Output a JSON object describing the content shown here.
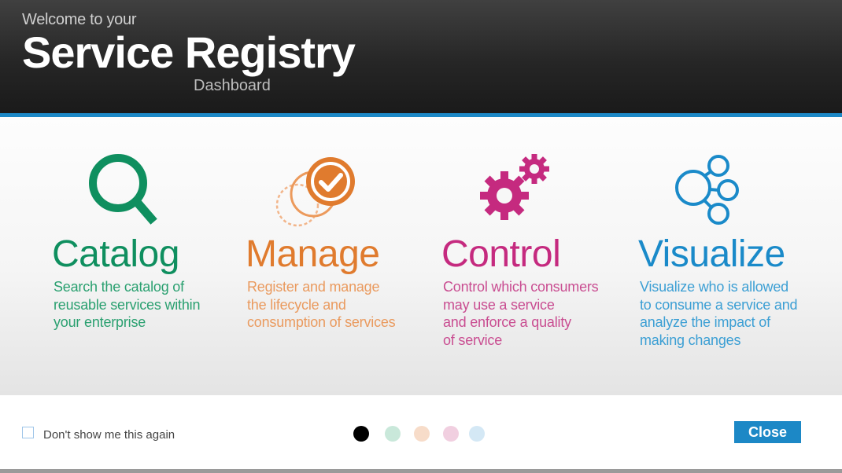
{
  "header": {
    "welcome": "Welcome to your",
    "title": "Service Registry",
    "subtitle": "Dashboard"
  },
  "features": [
    {
      "title": "Catalog",
      "icon": "magnifier-icon",
      "color": "#0f8f5f",
      "text_color": "#2aa070",
      "lines": [
        "Search the catalog of",
        "reusable services within",
        "your enterprise"
      ]
    },
    {
      "title": "Manage",
      "icon": "checkmark-circles-icon",
      "color": "#e07b2e",
      "text_color": "#ea9a5e",
      "lines": [
        "Register and manage",
        "the lifecycle and",
        "consumption of services"
      ]
    },
    {
      "title": "Control",
      "icon": "gears-icon",
      "color": "#c52a7f",
      "text_color": "#c94d91",
      "lines": [
        "Control which consumers",
        "may use a service",
        "and enforce a quality",
        "of service"
      ]
    },
    {
      "title": "Visualize",
      "icon": "network-icon",
      "color": "#1a8ac9",
      "text_color": "#3c9fd4",
      "lines": [
        "Visualize who is allowed",
        "to consume a service and",
        "analyze the impact of",
        "making changes"
      ]
    }
  ],
  "footer": {
    "checkbox_label": "Don't show me this again",
    "checkbox_checked": false,
    "close_label": "Close",
    "pager": {
      "current_page": 1,
      "dot_colors": [
        "#000000",
        "#c9e8da",
        "#f7dcc9",
        "#f1cfe0",
        "#d4e8f5"
      ]
    }
  }
}
